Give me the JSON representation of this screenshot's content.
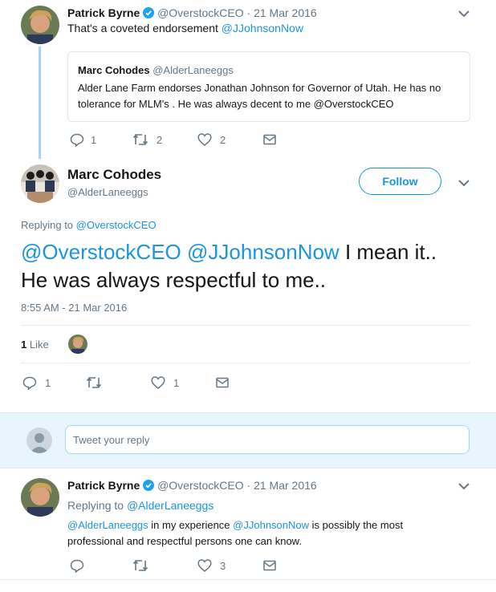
{
  "tweet1": {
    "author": "Patrick Byrne",
    "handle": "@OverstockCEO",
    "sep": "·",
    "date": "21 Mar 2016",
    "text_before": "That's a coveted endorsement ",
    "mention": "@JJohnsonNow",
    "quote": {
      "author": "Marc Cohodes",
      "handle": "@AlderLaneeggs",
      "text": "Alder Lane Farm endorses Jonathan Johnson for Governor of Utah. He has no tolerance for MLM's . He was always decent to me @OverstockCEO"
    },
    "replies": "1",
    "retweets": "2",
    "likes": "2"
  },
  "main_tweet": {
    "author": "Marc Cohodes",
    "handle": "@AlderLaneeggs",
    "follow_label": "Follow",
    "replying_to_label": "Replying to",
    "replying_to": "@OverstockCEO",
    "mention1": "@OverstockCEO",
    "mention2": "@JJohnsonNow",
    "text_line1_rest": " I mean it..",
    "text_line2": "He was always respectful to me..",
    "timestamp": "8:55 AM - 21 Mar 2016",
    "like_count": "1",
    "like_label": "Like",
    "replies": "1",
    "likes": "1"
  },
  "reply_box": {
    "placeholder": "Tweet your reply"
  },
  "tweet3": {
    "author": "Patrick Byrne",
    "handle": "@OverstockCEO",
    "sep": "·",
    "date": "21 Mar 2016",
    "replying_to_label": "Replying to",
    "replying_to": "@AlderLaneeggs",
    "mention1": "@AlderLaneeggs",
    "text1": " in my experience ",
    "mention2": "@JJohnsonNow",
    "text2": " is possibly the most professional and respectful persons one can know.",
    "likes": "3"
  },
  "colors": {
    "accent": "#1b95e0",
    "verified": "#1da1f2",
    "muted": "#657786"
  }
}
